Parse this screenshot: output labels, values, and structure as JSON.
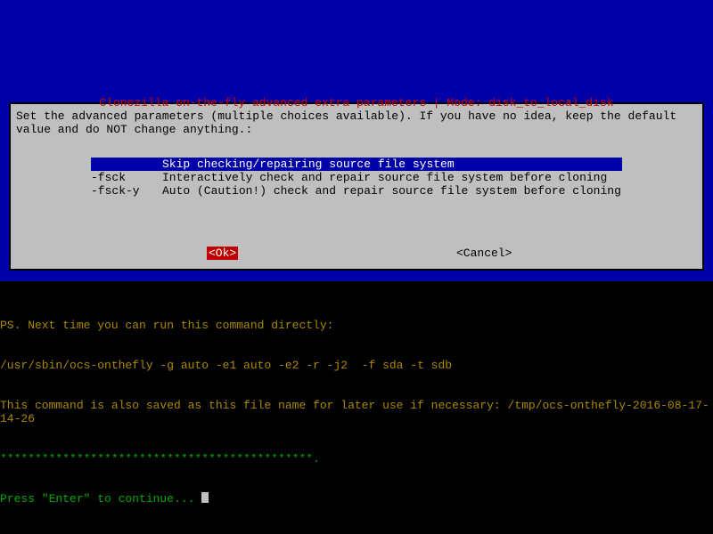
{
  "dialog": {
    "title": " Clonezilla on-the-fly advanced extra parameters | Mode: disk_to_local_disk ",
    "instruction": "Set the advanced parameters (multiple choices available). If you have no idea, keep the default value and do NOT change anything.:",
    "options": [
      {
        "flag": "",
        "desc": "Skip checking/repairing source file system",
        "selected": true
      },
      {
        "flag": "-fsck",
        "desc": "Interactively check and repair source file system before cloning",
        "selected": false
      },
      {
        "flag": "-fsck-y",
        "desc": "Auto (Caution!) check and repair source file system before cloning",
        "selected": false
      }
    ],
    "ok_label": "<Ok>",
    "cancel_label": "<Cancel>"
  },
  "terminal": {
    "line1": "PS. Next time you can run this command directly:",
    "line2": "/usr/sbin/ocs-onthefly -g auto -e1 auto -e2 -r -j2  -f sda -t sdb",
    "line3": "This command is also saved as this file name for later use if necessary: /tmp/ocs-onthefly-2016-08-17-14-26",
    "line4": "*********************************************.",
    "line5": "Press \"Enter\" to continue... "
  }
}
